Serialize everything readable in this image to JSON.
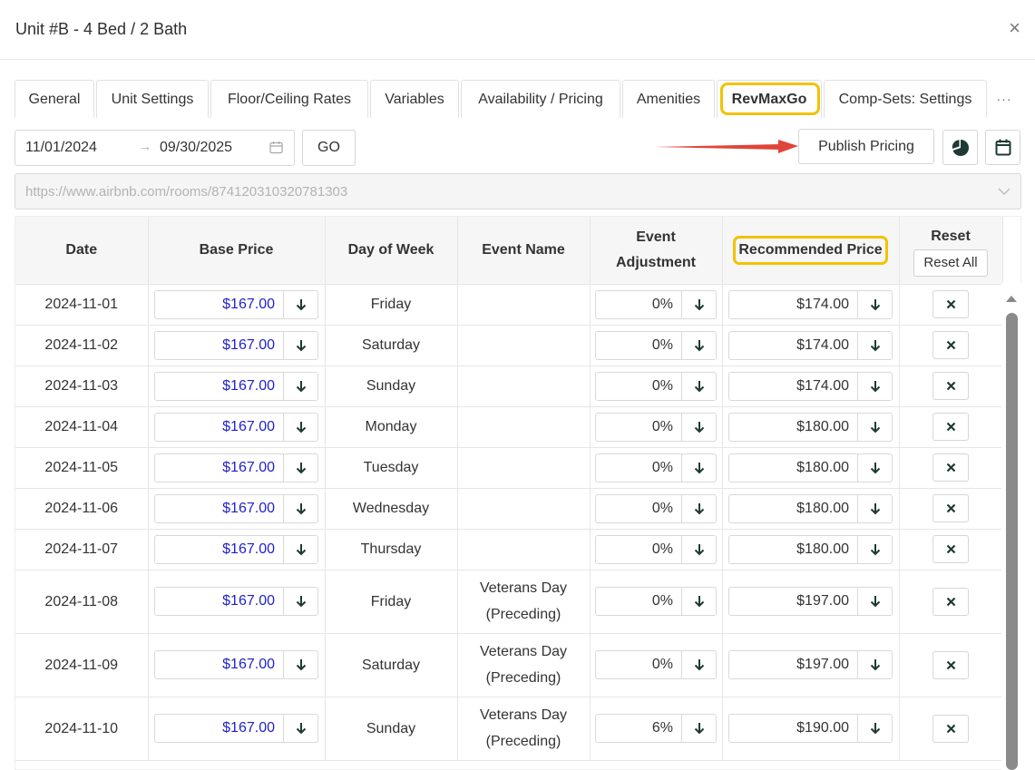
{
  "dialog": {
    "title": "Unit #B - 4 Bed / 2 Bath",
    "close_glyph": "×"
  },
  "tabs": [
    {
      "label": "General"
    },
    {
      "label": "Unit Settings"
    },
    {
      "label": "Floor/Ceiling Rates"
    },
    {
      "label": "Variables"
    },
    {
      "label": "Availability / Pricing"
    },
    {
      "label": "Amenities"
    },
    {
      "label": "RevMaxGo",
      "active": true
    },
    {
      "label": "Comp-Sets: Settings"
    }
  ],
  "tabs_more_glyph": "···",
  "date_range": {
    "start": "11/01/2024",
    "separator": "→",
    "end": "09/30/2025"
  },
  "go_label": "GO",
  "publish_label": "Publish Pricing",
  "url": {
    "value": "https://www.airbnb.com/rooms/874120310320781303"
  },
  "table": {
    "headers": {
      "date": "Date",
      "base_price": "Base Price",
      "day_of_week": "Day of Week",
      "event_name": "Event Name",
      "event_adjustment": "Event Adjustment",
      "recommended_price": "Recommended Price",
      "reset": "Reset",
      "reset_all": "Reset All"
    },
    "rows": [
      {
        "date": "2024-11-01",
        "base": "$167.00",
        "day": "Friday",
        "event": "",
        "adj": "0%",
        "rec": "$174.00"
      },
      {
        "date": "2024-11-02",
        "base": "$167.00",
        "day": "Saturday",
        "event": "",
        "adj": "0%",
        "rec": "$174.00"
      },
      {
        "date": "2024-11-03",
        "base": "$167.00",
        "day": "Sunday",
        "event": "",
        "adj": "0%",
        "rec": "$174.00"
      },
      {
        "date": "2024-11-04",
        "base": "$167.00",
        "day": "Monday",
        "event": "",
        "adj": "0%",
        "rec": "$180.00"
      },
      {
        "date": "2024-11-05",
        "base": "$167.00",
        "day": "Tuesday",
        "event": "",
        "adj": "0%",
        "rec": "$180.00"
      },
      {
        "date": "2024-11-06",
        "base": "$167.00",
        "day": "Wednesday",
        "event": "",
        "adj": "0%",
        "rec": "$180.00"
      },
      {
        "date": "2024-11-07",
        "base": "$167.00",
        "day": "Thursday",
        "event": "",
        "adj": "0%",
        "rec": "$180.00"
      },
      {
        "date": "2024-11-08",
        "base": "$167.00",
        "day": "Friday",
        "event": "Veterans Day (Preceding)",
        "adj": "0%",
        "rec": "$197.00"
      },
      {
        "date": "2024-11-09",
        "base": "$167.00",
        "day": "Saturday",
        "event": "Veterans Day (Preceding)",
        "adj": "0%",
        "rec": "$197.00"
      },
      {
        "date": "2024-11-10",
        "base": "$167.00",
        "day": "Sunday",
        "event": "Veterans Day (Preceding)",
        "adj": "6%",
        "rec": "$190.00"
      }
    ]
  },
  "colors": {
    "highlight": "#f2c200",
    "base_price_text": "#1f1fcf",
    "arrow": "#e0453a",
    "icon_dark": "#1e3a34"
  }
}
